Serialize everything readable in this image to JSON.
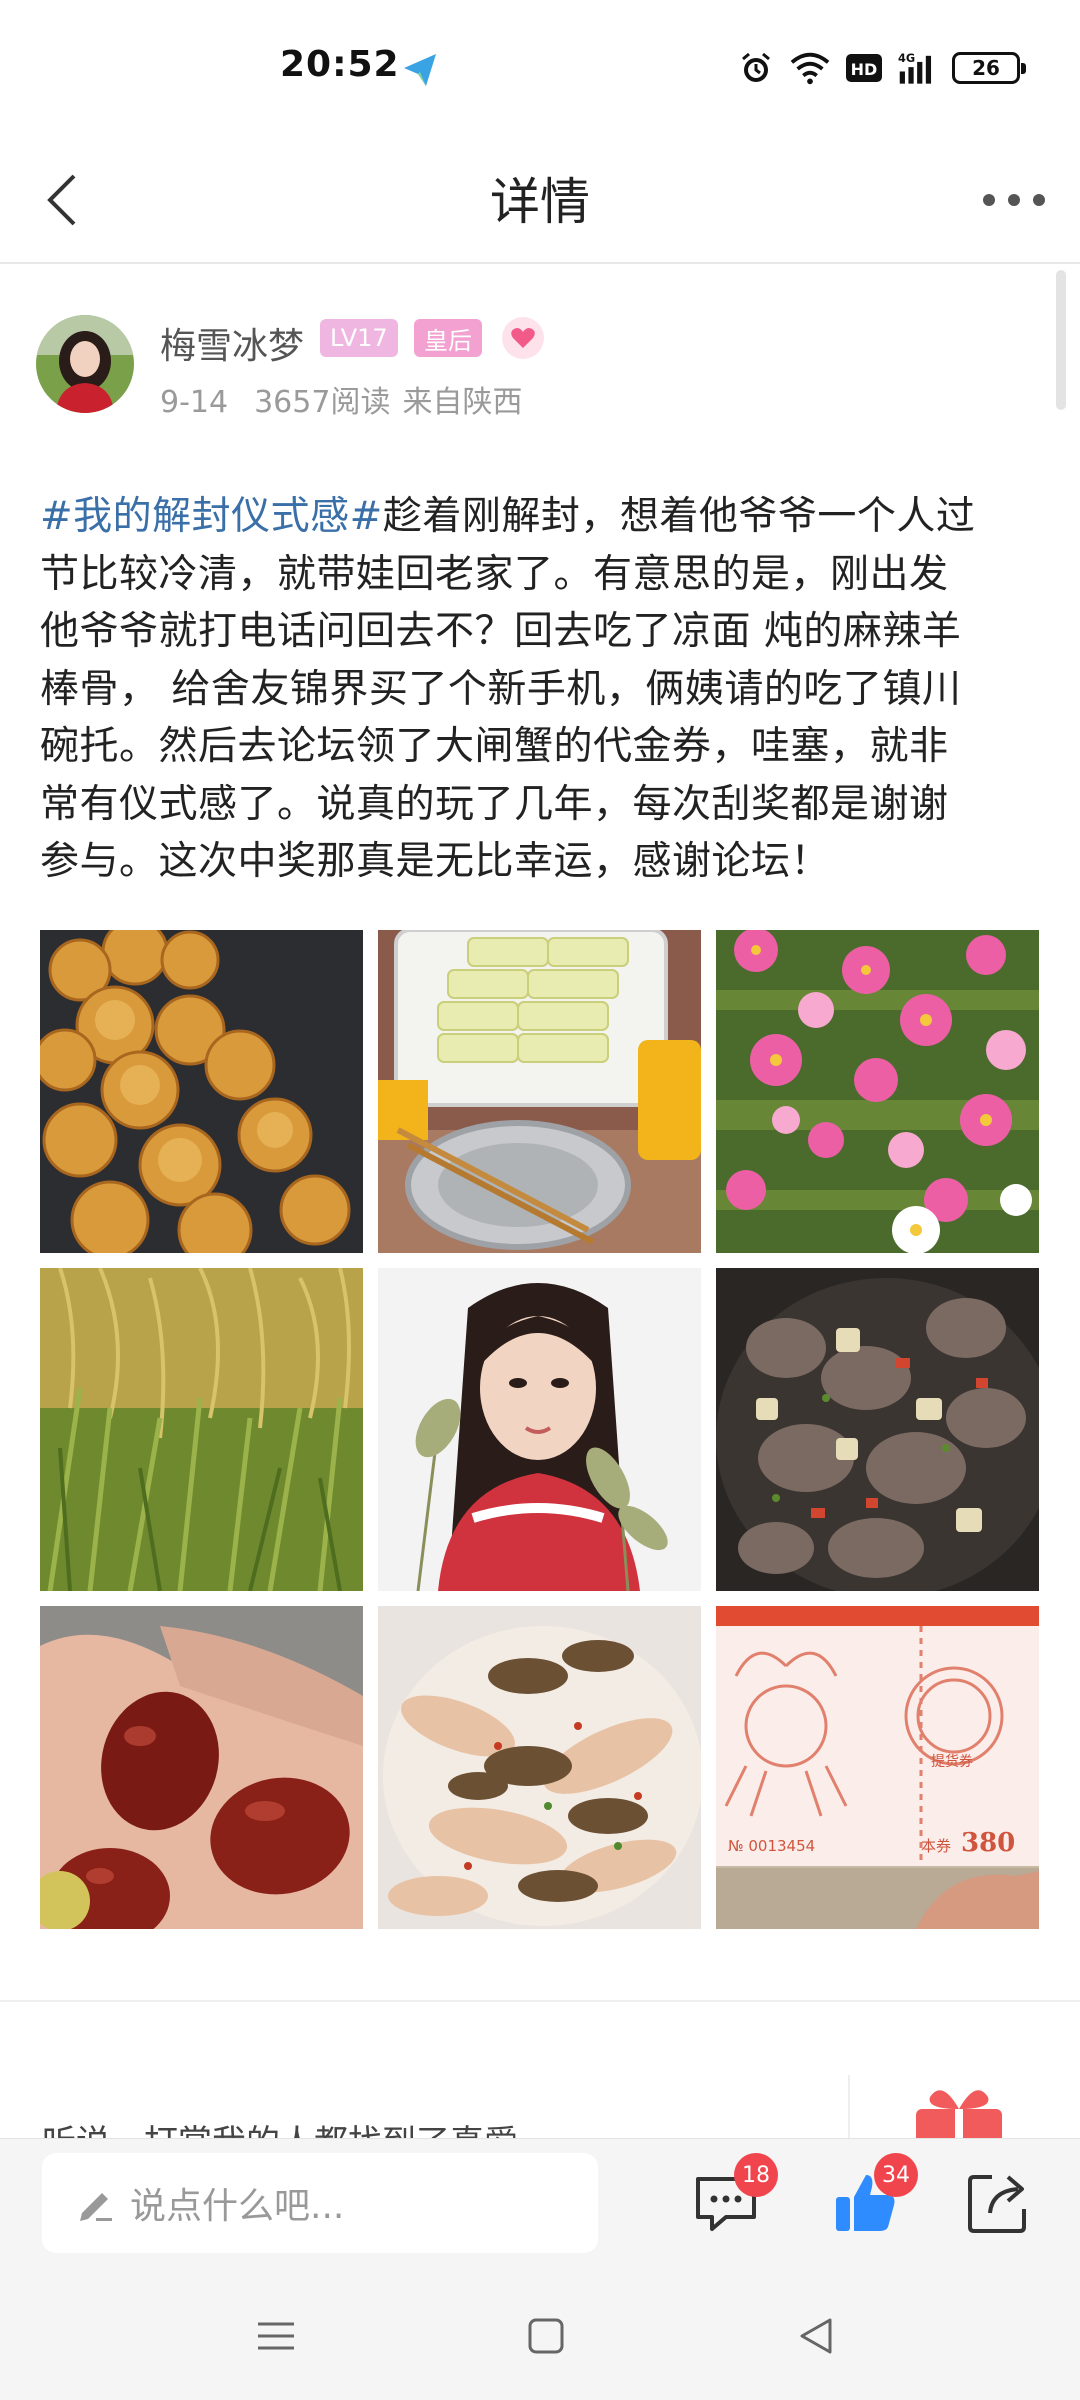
{
  "status_bar": {
    "time": "20:52",
    "battery": "26",
    "icons": [
      "telegram-icon",
      "alarm-icon",
      "wifi-icon",
      "hd-icon",
      "signal-4g-icon",
      "battery-icon"
    ]
  },
  "nav": {
    "title": "详情",
    "back_icon": "chevron-left-icon",
    "more_icon": "more-dots-icon"
  },
  "author": {
    "name": "梅雪冰梦",
    "level_badge": "LV17",
    "title_badge": "皇后",
    "heart_icon": "heart-icon",
    "date": "9-14",
    "reads": "3657阅读",
    "location": "来自陕西"
  },
  "post": {
    "lines": [
      {
        "tag": "#我的解封仪式感#",
        "text": "趁着刚解封，想着他爷爷一个人过"
      },
      {
        "tag": "",
        "text": "节比较冷清，就带娃回老家了。有意思的是，刚出发"
      },
      {
        "tag": "",
        "text": "他爷爷就打电话问回去不？回去吃了凉面  炖的麻辣羊"
      },
      {
        "tag": "",
        "text": "棒骨， 给舍友锦界买了个新手机，俩姨请的吃了镇川"
      },
      {
        "tag": "",
        "text": "碗托。然后去论坛领了大闸蟹的代金券，哇塞，就非"
      },
      {
        "tag": "",
        "text": "常有仪式感了。说真的玩了几年，每次刮奖都是谢谢"
      },
      {
        "tag": "",
        "text": "参与。这次中奖那真是无比幸运，感谢论坛！"
      }
    ]
  },
  "photos": [
    {
      "subject": "baked-pastries"
    },
    {
      "subject": "cold-noodles-and-bowl"
    },
    {
      "subject": "pink-cosmos-flowers"
    },
    {
      "subject": "rice-paddy"
    },
    {
      "subject": "woman-selfie"
    },
    {
      "subject": "braised-lamb"
    },
    {
      "subject": "red-dates"
    },
    {
      "subject": "noodles-with-meat"
    },
    {
      "subject": "crab-voucher"
    }
  ],
  "voucher": {
    "value": "380",
    "label": "本券",
    "serial": "№ 0013454",
    "stamp": "提货券"
  },
  "reward": {
    "text": "听说，打赏我的人都找到了真爱",
    "gift_icon": "gift-icon"
  },
  "action_bar": {
    "comment_placeholder": "说点什么吧...",
    "comment_count": "18",
    "like_count": "34",
    "icons": [
      "pencil-icon",
      "comment-icon",
      "thumbs-up-icon",
      "share-icon"
    ]
  },
  "system_nav": {
    "icons": [
      "menu-icon",
      "home-icon",
      "back-triangle-icon"
    ]
  },
  "colors": {
    "tag": "#3a6fa8",
    "badge_lv": "#f0b6e2",
    "badge_queen": "#f3a1d1",
    "like_blue": "#2f8cff",
    "count_red": "#f0454d",
    "gift_red": "#f25b5b"
  }
}
